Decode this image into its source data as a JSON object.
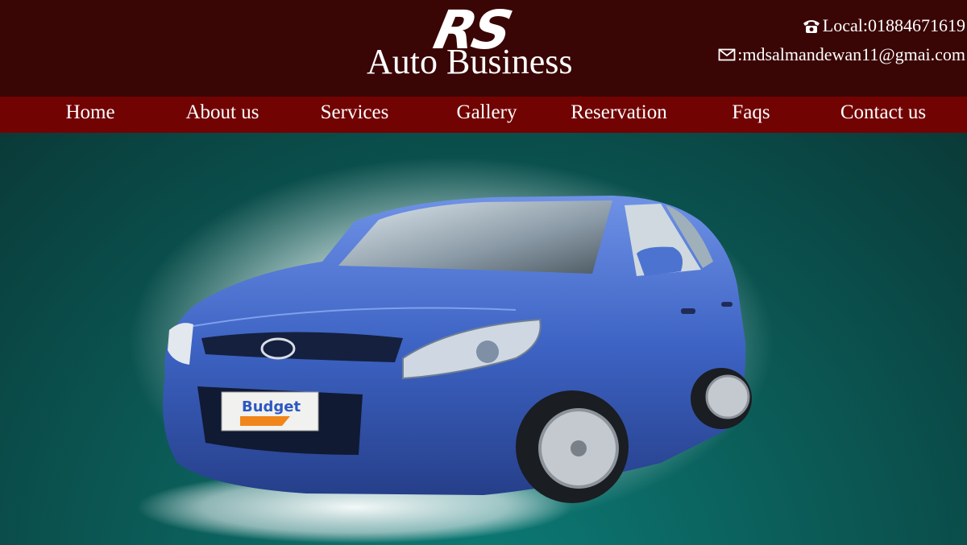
{
  "header": {
    "logo_mark": "RS",
    "logo_name": "Auto Business",
    "phone": "Local:01884671619",
    "email": ":mdsalmandewan11@gmai.com"
  },
  "nav": {
    "items": [
      "Home",
      "About us",
      "Services",
      "Gallery",
      "Reservation",
      "Faqs",
      "Contact us"
    ]
  },
  "hero": {
    "plate_text": "Budget",
    "car_color": "#3d63c4"
  },
  "colors": {
    "header_bg": "#3a0505",
    "nav_bg": "#720303",
    "hero_bg": "#0b5e5a"
  }
}
